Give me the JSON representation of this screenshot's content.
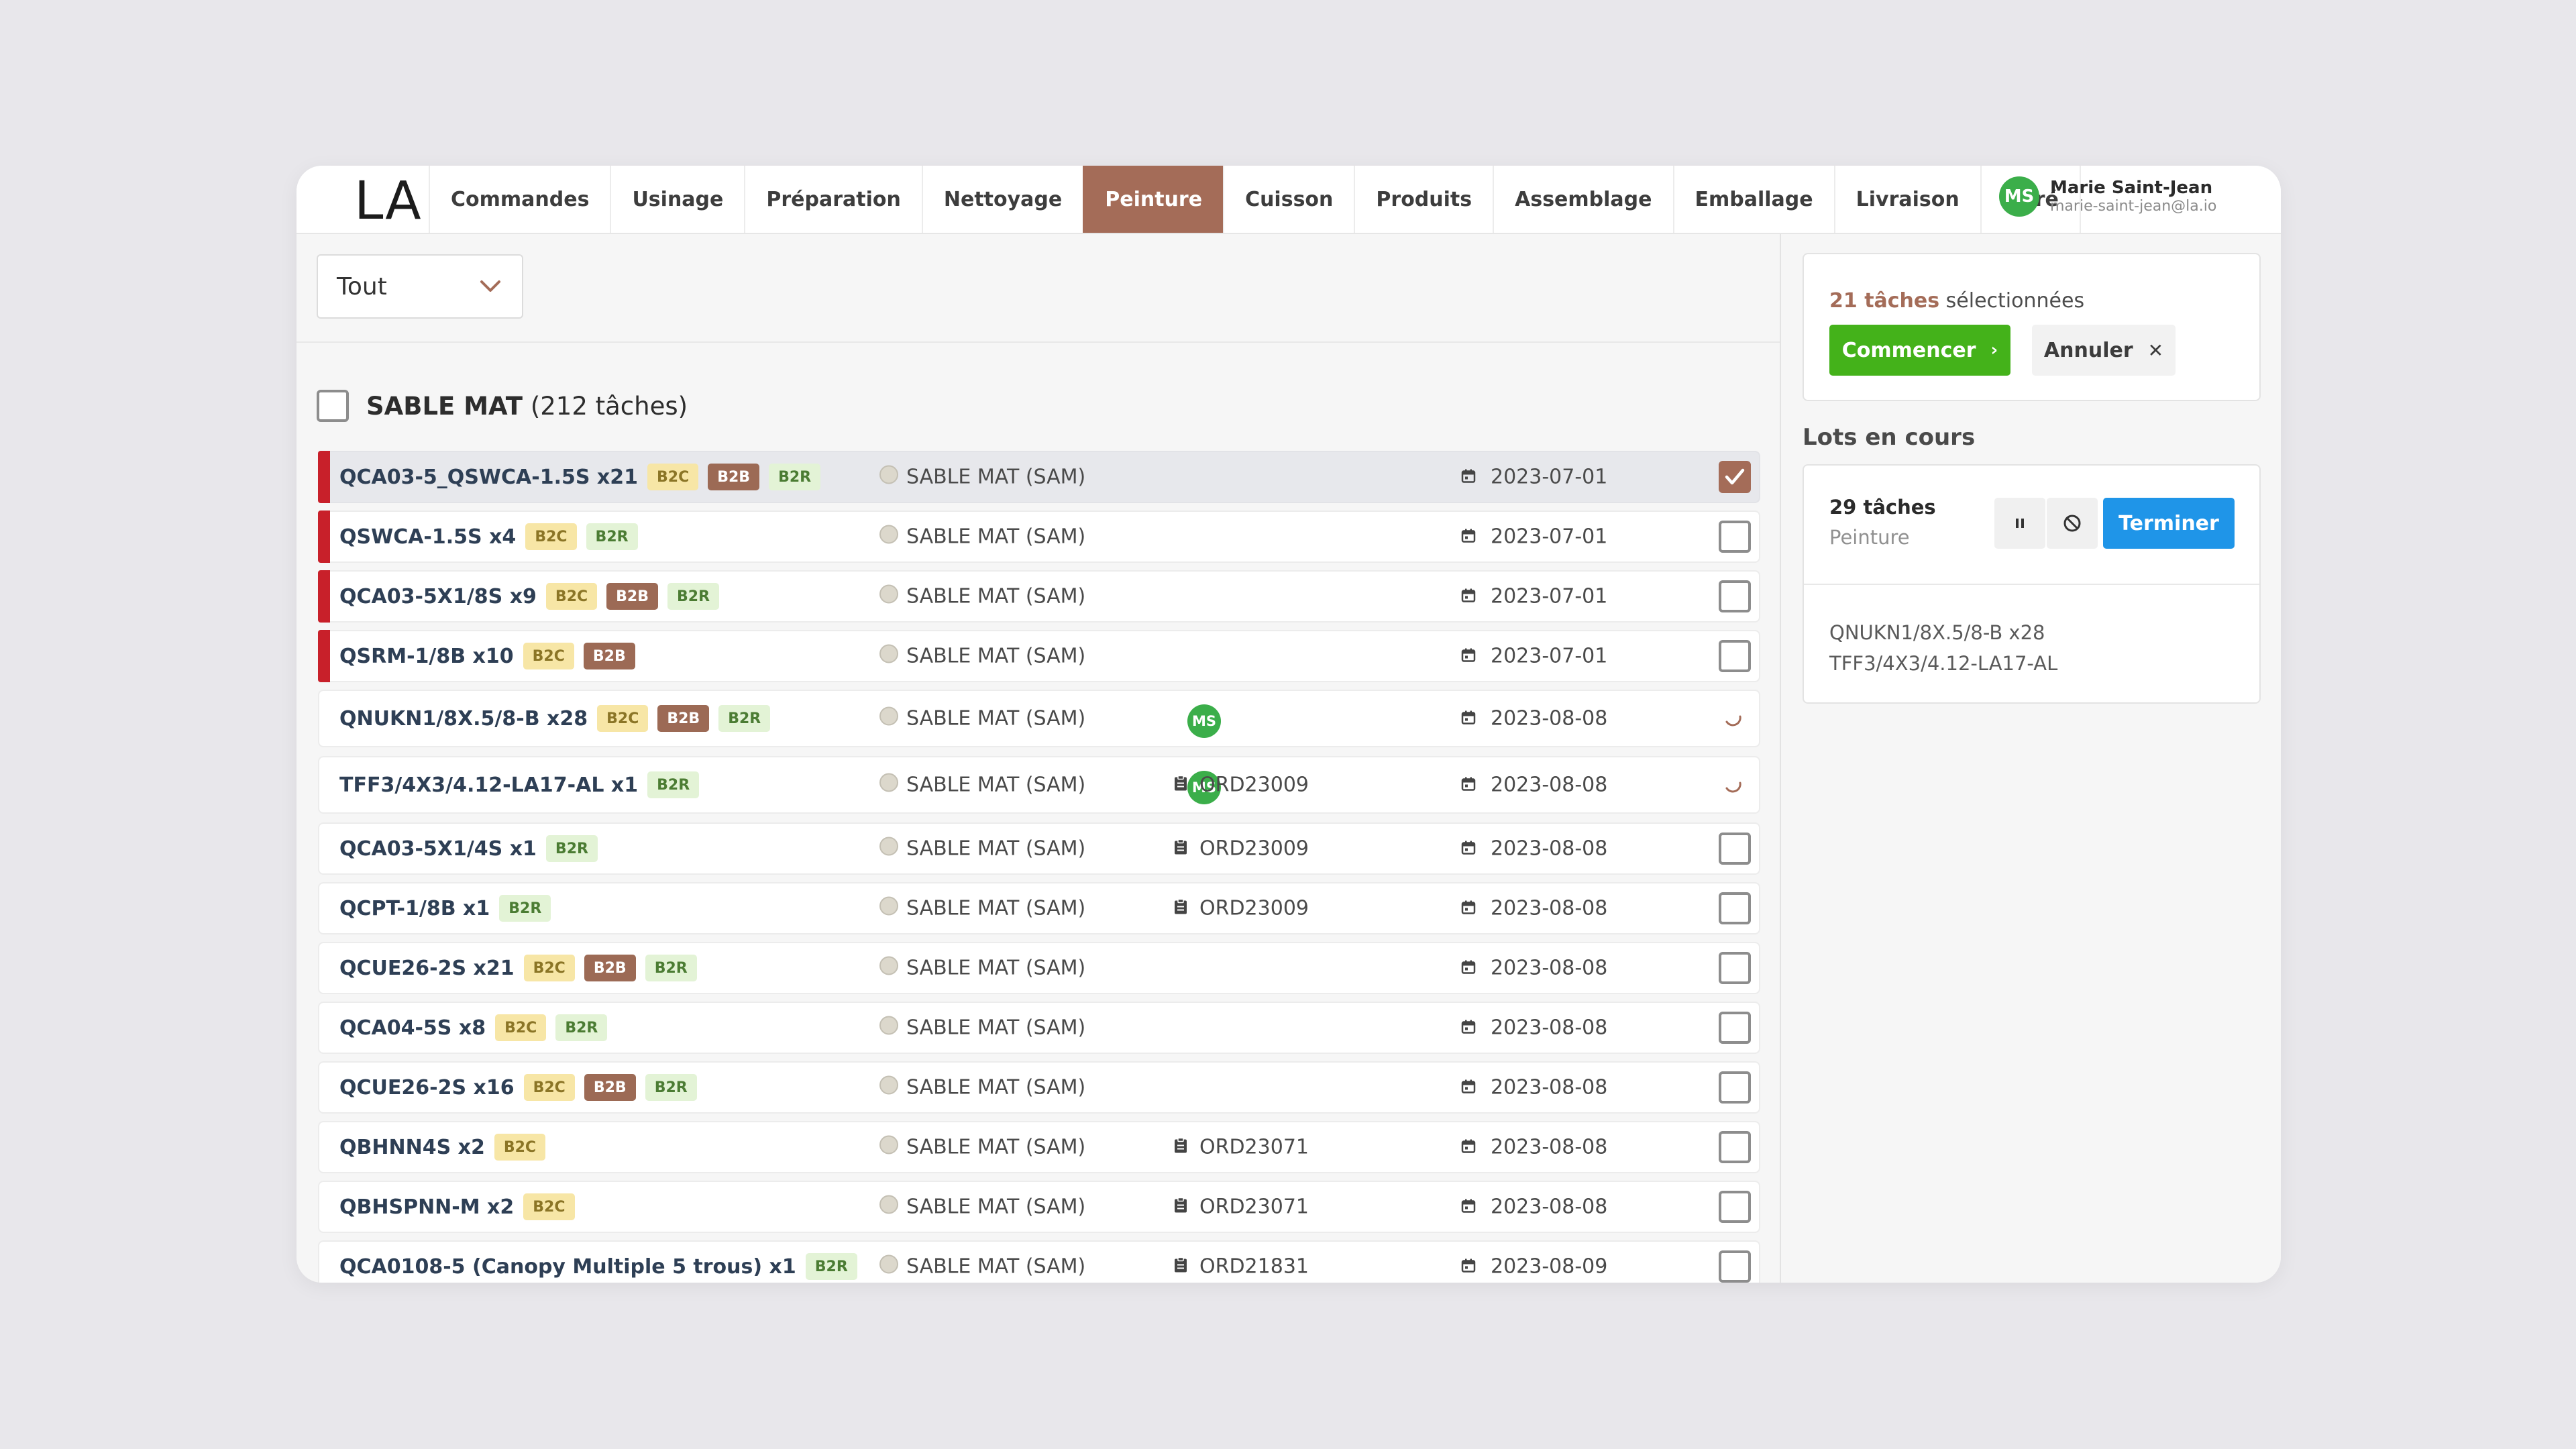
{
  "app": {
    "logo": "LA",
    "tabs": [
      "Commandes",
      "Usinage",
      "Préparation",
      "Nettoyage",
      "Peinture",
      "Cuisson",
      "Produits",
      "Assemblage",
      "Emballage",
      "Livraison",
      "Livré"
    ],
    "active_tab": "Peinture",
    "user": {
      "initials": "MS",
      "name": "Marie Saint-Jean",
      "email": "marie-saint-jean@la.io"
    }
  },
  "filter": {
    "value": "Tout"
  },
  "group": {
    "title": "SABLE MAT",
    "count_label": "(212 tâches)"
  },
  "rows": [
    {
      "code": "QCA03-5_QSWCA-1.5S x21",
      "badges": [
        "B2C",
        "B2B",
        "B2R"
      ],
      "material": "SABLE MAT (SAM)",
      "date": "2023-07-01",
      "flag": true,
      "selected": true,
      "status": "checked"
    },
    {
      "code": "QSWCA-1.5S x4",
      "badges": [
        "B2C",
        "B2R"
      ],
      "material": "SABLE MAT (SAM)",
      "date": "2023-07-01",
      "flag": true,
      "status": "unchecked"
    },
    {
      "code": "QCA03-5X1/8S x9",
      "badges": [
        "B2C",
        "B2B",
        "B2R"
      ],
      "material": "SABLE MAT (SAM)",
      "date": "2023-07-01",
      "flag": true,
      "status": "unchecked"
    },
    {
      "code": "QSRM-1/8B x10",
      "badges": [
        "B2C",
        "B2B"
      ],
      "material": "SABLE MAT (SAM)",
      "date": "2023-07-01",
      "flag": true,
      "status": "unchecked"
    },
    {
      "code": "QNUKN1/8X.5/8-B x28",
      "badges": [
        "B2C",
        "B2B",
        "B2R"
      ],
      "material": "SABLE MAT (SAM)",
      "assignee": "MS",
      "date": "2023-08-08",
      "status": "in-progress"
    },
    {
      "code": "TFF3/4X3/4.12-LA17-AL x1",
      "badges": [
        "B2R"
      ],
      "material": "SABLE MAT (SAM)",
      "assignee": "MS",
      "order": "ORD23009",
      "date": "2023-08-08",
      "status": "in-progress"
    },
    {
      "code": "QCA03-5X1/4S x1",
      "badges": [
        "B2R"
      ],
      "material": "SABLE MAT (SAM)",
      "order": "ORD23009",
      "date": "2023-08-08",
      "status": "unchecked"
    },
    {
      "code": "QCPT-1/8B x1",
      "badges": [
        "B2R"
      ],
      "material": "SABLE MAT (SAM)",
      "order": "ORD23009",
      "date": "2023-08-08",
      "status": "unchecked"
    },
    {
      "code": "QCUE26-2S x21",
      "badges": [
        "B2C",
        "B2B",
        "B2R"
      ],
      "material": "SABLE MAT (SAM)",
      "date": "2023-08-08",
      "status": "unchecked"
    },
    {
      "code": "QCA04-5S x8",
      "badges": [
        "B2C",
        "B2R"
      ],
      "material": "SABLE MAT (SAM)",
      "date": "2023-08-08",
      "status": "unchecked"
    },
    {
      "code": "QCUE26-2S x16",
      "badges": [
        "B2C",
        "B2B",
        "B2R"
      ],
      "material": "SABLE MAT (SAM)",
      "date": "2023-08-08",
      "status": "unchecked"
    },
    {
      "code": "QBHNN4S x2",
      "badges": [
        "B2C"
      ],
      "material": "SABLE MAT (SAM)",
      "order": "ORD23071",
      "date": "2023-08-08",
      "status": "unchecked"
    },
    {
      "code": "QBHSPNN-M x2",
      "badges": [
        "B2C"
      ],
      "material": "SABLE MAT (SAM)",
      "order": "ORD23071",
      "date": "2023-08-08",
      "status": "unchecked"
    },
    {
      "code": "QCA0108-5 (Canopy Multiple 5 trous) x1",
      "badges": [
        "B2R"
      ],
      "material": "SABLE MAT (SAM)",
      "order": "ORD21831",
      "date": "2023-08-09",
      "status": "unchecked"
    }
  ],
  "selection": {
    "count_label": "21 tâches",
    "suffix": "sélectionnées",
    "start_label": "Commencer",
    "cancel_label": "Annuler"
  },
  "lots": {
    "title": "Lots en cours",
    "items": [
      {
        "count_label": "29 tâches",
        "step": "Peinture",
        "finish_label": "Terminer",
        "tasks": [
          "QNUKN1/8X.5/8-B x28",
          "TFF3/4X3/4.12-LA17-AL"
        ]
      }
    ]
  },
  "colors": {
    "accent": "#a46c58",
    "flag": "#c8202a",
    "start_button": "#44b21a",
    "finish_button": "#1f95e8",
    "avatar": "#3bae4a",
    "badge_b2c": "#f7e6a6",
    "badge_b2b": "#9c6a55",
    "badge_b2r": "#e3f3d6"
  },
  "icons": {
    "select": "chevron-down-icon",
    "row_material": "circle-swatch-icon",
    "row_order": "clipboard-icon",
    "row_date": "calendar-icon",
    "row_progress": "spinner-icon",
    "start": "chevron-right-icon",
    "cancel": "close-icon",
    "pause": "pause-icon",
    "block": "block-icon"
  }
}
